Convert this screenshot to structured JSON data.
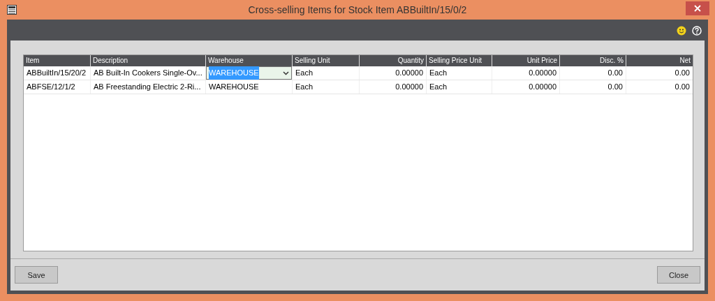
{
  "window": {
    "title": "Cross-selling Items for Stock Item ABBuiltIn/15/0/2"
  },
  "table": {
    "columns": [
      {
        "label": "Item",
        "kind": "text"
      },
      {
        "label": "Description",
        "kind": "text"
      },
      {
        "label": "Warehouse",
        "kind": "dropdown"
      },
      {
        "label": "Selling Unit",
        "kind": "text"
      },
      {
        "label": "Quantity",
        "kind": "number"
      },
      {
        "label": "Selling Price Unit",
        "kind": "text"
      },
      {
        "label": "Unit Price",
        "kind": "number"
      },
      {
        "label": "Disc. %",
        "kind": "number"
      },
      {
        "label": "Net",
        "kind": "number"
      }
    ],
    "rows": [
      {
        "editing": true,
        "cells": [
          "ABBuiltIn/15/20/2",
          "AB Built-In Cookers Single-Ov...",
          "WAREHOUSE",
          "Each",
          "0.00000",
          "Each",
          "0.00000",
          "0.00",
          "0.00"
        ]
      },
      {
        "editing": false,
        "cells": [
          "ABFSE/12/1/2",
          "AB Freestanding Electric 2-Ri...",
          "WAREHOUSE",
          "Each",
          "0.00000",
          "Each",
          "0.00000",
          "0.00",
          "0.00"
        ]
      }
    ]
  },
  "buttons": [
    {
      "label": "Save"
    },
    {
      "label": "Close"
    }
  ]
}
